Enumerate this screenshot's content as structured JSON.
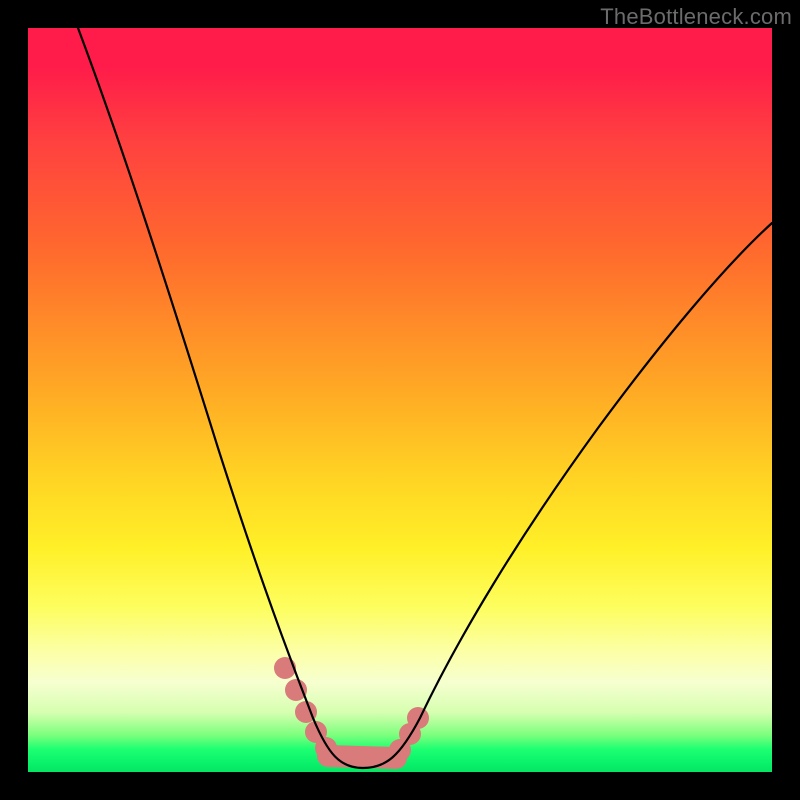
{
  "watermark": {
    "text": "TheBottleneck.com"
  },
  "chart_data": {
    "type": "line",
    "title": "",
    "xlabel": "",
    "ylabel": "",
    "xlim": [
      0,
      100
    ],
    "ylim": [
      0,
      100
    ],
    "grid": false,
    "legend": false,
    "background_gradient": {
      "stops": [
        {
          "pos": 0.0,
          "color": "#ff1b4a"
        },
        {
          "pos": 0.48,
          "color": "#ffa725"
        },
        {
          "pos": 0.7,
          "color": "#fff028"
        },
        {
          "pos": 0.97,
          "color": "#1bff71"
        },
        {
          "pos": 1.0,
          "color": "#05e564"
        }
      ]
    },
    "series": [
      {
        "name": "bottleneck-curve",
        "color": "#000000",
        "x": [
          6,
          10,
          14,
          18,
          22,
          26,
          30,
          33,
          36,
          38,
          40,
          43,
          47,
          50,
          54,
          58,
          63,
          70,
          80,
          90,
          100
        ],
        "y": [
          100,
          88,
          76,
          64,
          52,
          40,
          28,
          18,
          10,
          5,
          2,
          0.5,
          0.5,
          1.5,
          4,
          9,
          17,
          28,
          44,
          58,
          69
        ]
      }
    ],
    "highlight": {
      "name": "optimal-range",
      "color": "#d97b7b",
      "x": [
        34.5,
        36.5,
        38,
        39.5,
        41,
        43,
        45,
        47,
        49,
        50.5,
        52
      ],
      "y": [
        14,
        9,
        5,
        2.5,
        1,
        0.5,
        0.5,
        0.7,
        1.5,
        3.2,
        6
      ]
    }
  }
}
